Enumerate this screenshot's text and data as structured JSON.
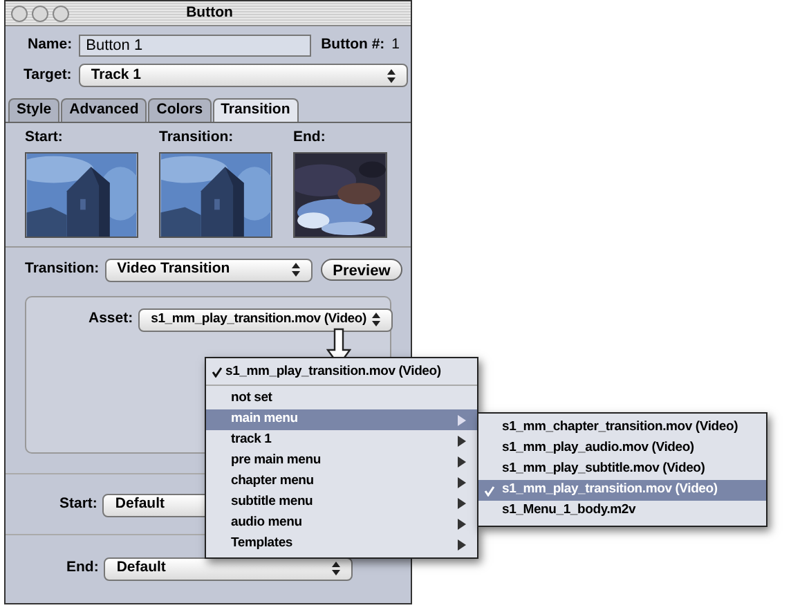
{
  "window": {
    "title": "Button"
  },
  "name": {
    "label": "Name:",
    "value": "Button 1"
  },
  "button_number": {
    "label": "Button #:",
    "value": "1"
  },
  "target": {
    "label": "Target:",
    "value": "Track 1"
  },
  "tabs": [
    {
      "label": "Style",
      "selected": false
    },
    {
      "label": "Advanced",
      "selected": false
    },
    {
      "label": "Colors",
      "selected": false
    },
    {
      "label": "Transition",
      "selected": true
    }
  ],
  "thumbnails": [
    {
      "label": "Start:"
    },
    {
      "label": "Transition:"
    },
    {
      "label": "End:"
    }
  ],
  "transition": {
    "label": "Transition:",
    "value": "Video Transition",
    "button": "Preview"
  },
  "asset": {
    "label": "Asset:",
    "value": "s1_mm_play_transition.mov (Video)"
  },
  "start": {
    "label": "Start:",
    "value": "Default"
  },
  "end": {
    "label": "End:",
    "value": "Default"
  },
  "menu": {
    "current": {
      "label": "s1_mm_play_transition.mov (Video)",
      "checked": true
    },
    "items": [
      {
        "label": "not set",
        "selected": false,
        "submenu": false
      },
      {
        "label": "main menu",
        "selected": true,
        "submenu": true
      },
      {
        "label": "track 1",
        "selected": false,
        "submenu": true
      },
      {
        "label": "pre main menu",
        "selected": false,
        "submenu": true
      },
      {
        "label": "chapter menu",
        "selected": false,
        "submenu": true
      },
      {
        "label": "subtitle menu",
        "selected": false,
        "submenu": true
      },
      {
        "label": "audio menu",
        "selected": false,
        "submenu": true
      },
      {
        "label": "Templates",
        "selected": false,
        "submenu": true
      }
    ]
  },
  "submenu": {
    "items": [
      {
        "label": "s1_mm_chapter_transition.mov (Video)",
        "checked": false,
        "selected": false
      },
      {
        "label": "s1_mm_play_audio.mov (Video)",
        "checked": false,
        "selected": false
      },
      {
        "label": "s1_mm_play_subtitle.mov (Video)",
        "checked": false,
        "selected": false
      },
      {
        "label": "s1_mm_play_transition.mov (Video)",
        "checked": true,
        "selected": true
      },
      {
        "label": "s1_Menu_1_body.m2v",
        "checked": false,
        "selected": false
      }
    ]
  }
}
